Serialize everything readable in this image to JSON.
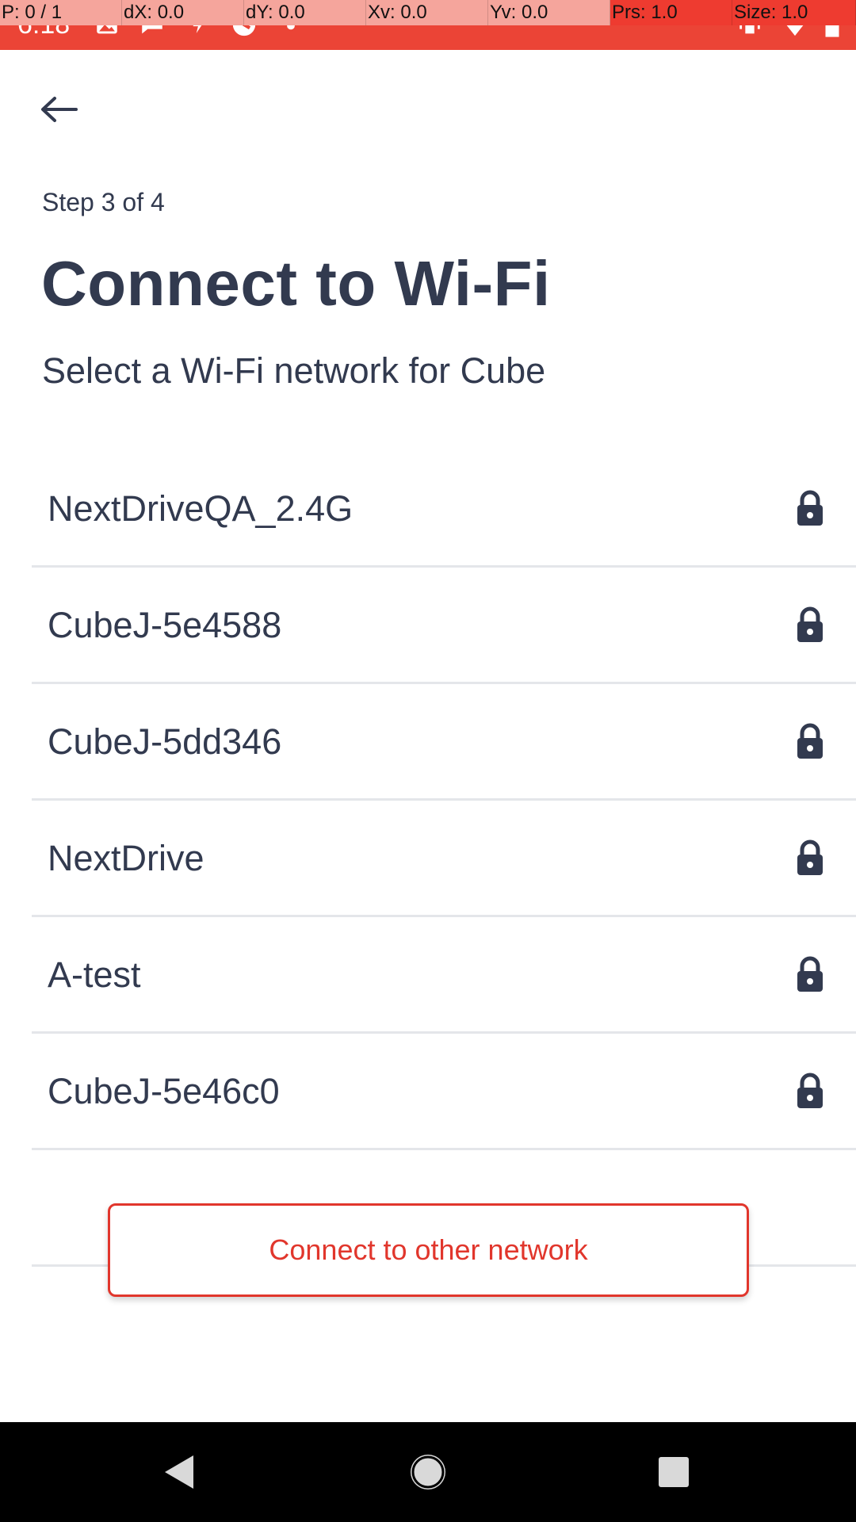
{
  "status_bar": {
    "time": "6:18",
    "debug": {
      "p": "P: 0 / 1",
      "dx": "dX: 0.0",
      "dy": "dY: 0.0",
      "xv": "Xv: 0.0",
      "yv": "Yv: 0.0",
      "prs": "Prs: 1.0",
      "size": "Size: 1.0"
    },
    "icons": [
      "image-icon",
      "chat-icon",
      "bolt-icon",
      "sync-icon",
      "dot-icon",
      "vibrate-icon",
      "wifi-icon",
      "battery-icon"
    ]
  },
  "header": {
    "back_icon": "arrow-left-icon",
    "step": "Step 3 of 4",
    "title": "Connect to Wi-Fi",
    "subtitle": "Select a Wi-Fi network for Cube"
  },
  "networks": [
    {
      "name": "NextDriveQA_2.4G",
      "icon": "lock-icon"
    },
    {
      "name": "CubeJ-5e4588",
      "icon": "lock-icon"
    },
    {
      "name": "CubeJ-5dd346",
      "icon": "lock-icon"
    },
    {
      "name": "NextDrive",
      "icon": "lock-icon"
    },
    {
      "name": "A-test",
      "icon": "lock-icon"
    },
    {
      "name": "CubeJ-5e46c0",
      "icon": "lock-icon"
    }
  ],
  "other_network_button": "Connect to other network",
  "colors": {
    "accent": "#e1362c",
    "status_bar": "#eb4436",
    "text": "#323a4f",
    "divider": "#e4e6ea"
  },
  "nav_bar": {
    "icons": [
      "nav-back-icon",
      "nav-home-icon",
      "nav-recents-icon"
    ]
  }
}
